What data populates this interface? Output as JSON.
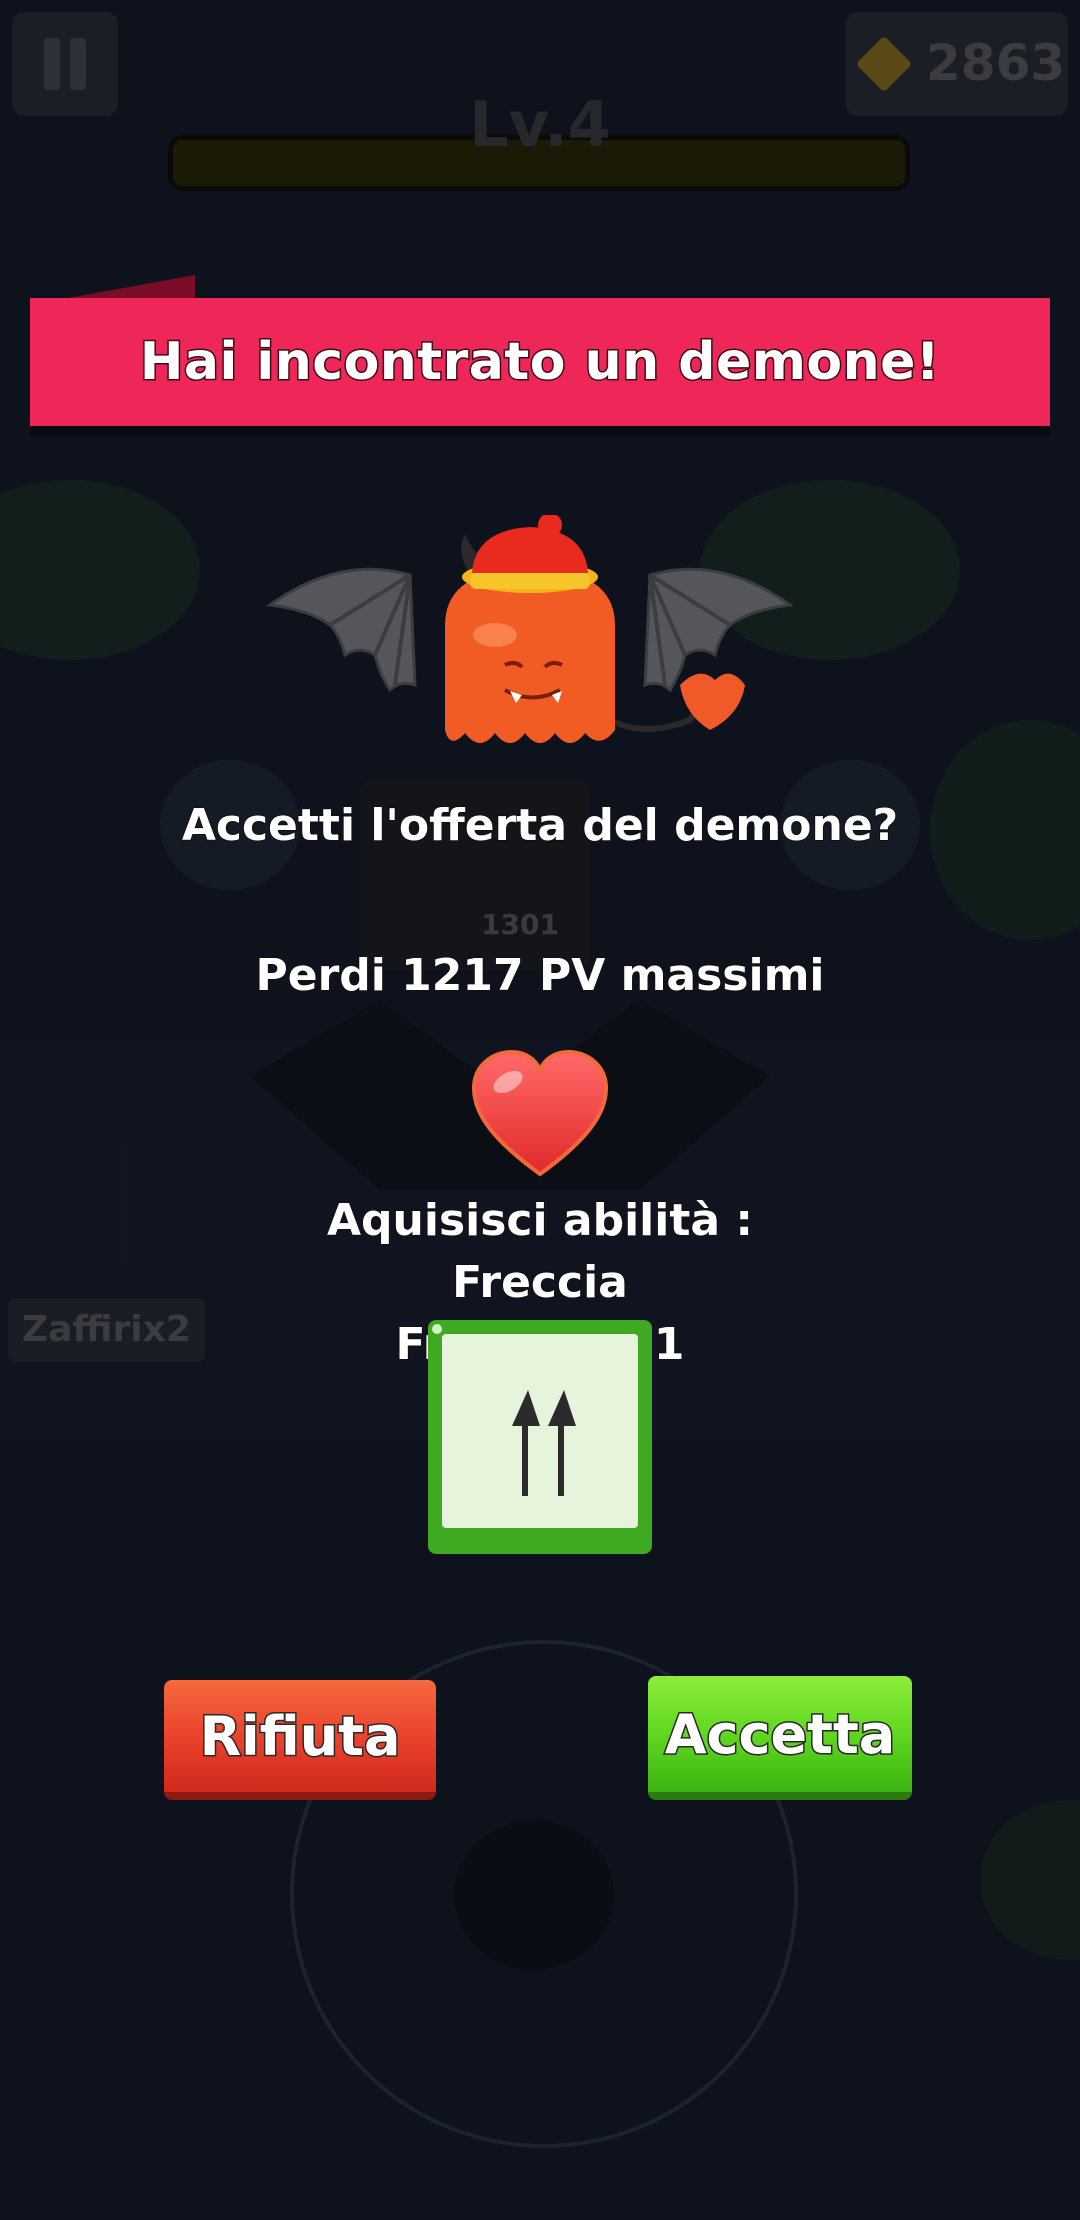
{
  "hud": {
    "gem_count": "2863",
    "level": "Lv.4",
    "icons": {
      "pause": "pause-icon",
      "gem": "gem-icon"
    }
  },
  "dialog": {
    "title": "Hai incontrato un demone!",
    "question": "Accetti l'offerta del demone?",
    "cost": "Perdi 1217 PV massimi",
    "reward_line1": "Aquisisci abilità : Freccia",
    "reward_line2": "Frontale +1",
    "icons": {
      "demon": "winged-demon-icon",
      "heart": "heart-icon",
      "skill": "double-arrow-icon"
    }
  },
  "buttons": {
    "reject": "Rifiuta",
    "accept": "Accetta"
  },
  "background": {
    "player_name": "Zaffirix2",
    "enemy_hp": "1301"
  },
  "colors": {
    "banner": "#ef2758",
    "reject": "#ea3f2b",
    "accept": "#5cd51e",
    "skill_frame": "#3faa21"
  }
}
